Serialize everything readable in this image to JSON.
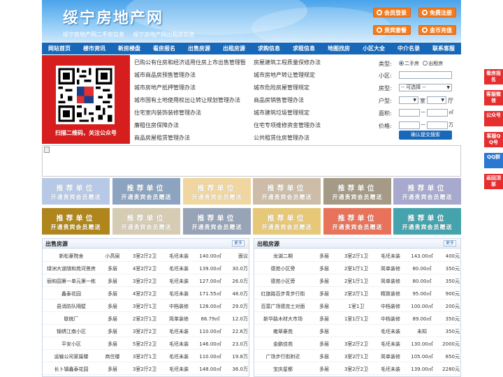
{
  "header": {
    "title": "绥宁房地产网",
    "subtitles": [
      "绥宁房地产网二手房信息",
      "绥宁房地产网出租房信息"
    ],
    "buttons": [
      "会员登录",
      "免费注册",
      "贵宾套餐",
      "金币充值"
    ]
  },
  "nav": [
    "网站首页",
    "楼市资讯",
    "新房楼盘",
    "看房报名",
    "出售房源",
    "出租房源",
    "求购信息",
    "求租信息",
    "地图找房",
    "小区大全",
    "中介名录",
    "联系客服"
  ],
  "qr": {
    "label": "扫描二维码，关注公众号"
  },
  "news": {
    "left": [
      "已购公有住房和经济适用住房上市出售管理暂",
      "城市商品房预售管理办法",
      "城市房地产抵押管理办法",
      "城市国有土地使用权出让转让规划管理办法",
      "住宅室内装饰装修管理办法",
      "廉租住房保障办法",
      "商品房屋租赁管理办法"
    ],
    "right": [
      "房屋建筑工程质量保修办法",
      "城市房地产转让管理规定",
      "城市危险房屋管理规定",
      "商品房销售管理办法",
      "城市建筑垃圾管理规定",
      "住宅专项维修资金管理办法",
      "公共租赁住房管理办法"
    ]
  },
  "search": {
    "type_label": "类型:",
    "type_options": [
      "二手房",
      "出租房"
    ],
    "type_selected": "二手房",
    "community_label": "小区:",
    "community_value": "",
    "house_type_label": "房型:",
    "house_type_value": "-- 可选择 --",
    "layout_label": "户型:",
    "room_unit": "室",
    "hall_unit": "厅",
    "area_label": "面积:",
    "area_unit": "㎡",
    "price_label": "价格:",
    "price_unit": "万",
    "range_sep": "—",
    "submit": "确认提交搜索"
  },
  "ads": {
    "line1": "推荐单位",
    "line2": "开通贵宾会员赠送",
    "colors": [
      "#b7c9e6",
      "#8da4c0",
      "#f0d6a0",
      "#cdbda8",
      "#a49a86",
      "#a7a9cf",
      "#b0861c",
      "#d6cbb3",
      "#97a4b8",
      "#e7c878",
      "#e8735a",
      "#45a3ad"
    ]
  },
  "sale": {
    "title": "出售房源",
    "more": "更多",
    "rows": [
      [
        "新松豪院舍",
        "小高层",
        "3室2厅2卫",
        "毛坯未装",
        "140.00㎡",
        "面议"
      ],
      [
        "绿洲大道隧和苑河景房",
        "多层",
        "4室2厅2卫",
        "毛坯未装",
        "139.00㎡",
        "30.0万"
      ],
      [
        "丽和园第一单元第一栋",
        "多层",
        "3室2厅2卫",
        "毛坯未装",
        "127.00㎡",
        "26.0万"
      ],
      [
        "鑫泰花园",
        "多层",
        "4室2厅2卫",
        "毛坯未装",
        "171.55㎡",
        "48.0万"
      ],
      [
        "县消防队隔壁",
        "多层",
        "3室2厅1卫",
        "中档装修",
        "128.00㎡",
        "29.0万"
      ],
      [
        "联统厂",
        "多层",
        "2室2厅1卫",
        "简单装修",
        "66.79㎡",
        "12.0万"
      ],
      [
        "锦绣江南小区",
        "多层",
        "3室2厅2卫",
        "毛坯未装",
        "110.00㎡",
        "22.6万"
      ],
      [
        "平安小区",
        "多层",
        "5室2厅2卫",
        "毛坯未装",
        "146.00㎡",
        "23.0万"
      ],
      [
        "运输公司家属楼",
        "商住楼",
        "3室2厅1卫",
        "毛坯未装",
        "110.00㎡",
        "19.8万"
      ],
      [
        "长卜镇鑫泰花园",
        "多层",
        "3室2厅2卫",
        "毛坯未装",
        "148.00㎡",
        "36.0万"
      ]
    ]
  },
  "rent": {
    "title": "出租房源",
    "more": "更多",
    "rows": [
      [
        "龙湖二期",
        "多层",
        "3室2厅1卫",
        "毛坯未装",
        "143.00㎡",
        "400元"
      ],
      [
        "德苑小区旁",
        "多层",
        "2室1厅1卫",
        "简单装修",
        "80.00㎡",
        "350元"
      ],
      [
        "德苑小区旁",
        "多层",
        "2室1厅1卫",
        "简单装修",
        "80.00㎡",
        "350元"
      ],
      [
        "红旗路百步青步行街",
        "多层",
        "2室2厅1卫",
        "精致装修",
        "95.00㎡",
        "900元"
      ],
      [
        "百富广场德克士对面",
        "多层",
        "1室1卫",
        "中档装修",
        "100.00㎡",
        "200元"
      ],
      [
        "新华路木材大市场",
        "多层",
        "1室1厅1卫",
        "中档装修",
        "89.00㎡",
        "350元"
      ],
      [
        "雍翠豪苑",
        "多层",
        "",
        "毛坯未装",
        "未知",
        "350元"
      ],
      [
        "金鹏佳苑",
        "多层",
        "3室2厅2卫",
        "毛坯未装",
        "130.00㎡",
        "2000元"
      ],
      [
        "广场步行街附近",
        "多层",
        "3室2厅1卫",
        "简单装修",
        "105.00㎡",
        "850元"
      ],
      [
        "宝庆星都",
        "多层",
        "3室2厅2卫",
        "毛坯未装",
        "139.00㎡",
        "2280元"
      ]
    ]
  },
  "float": [
    "看房报名",
    "客服微信",
    "公众号",
    "客服QQ号",
    "QQ群",
    "返回顶部"
  ]
}
